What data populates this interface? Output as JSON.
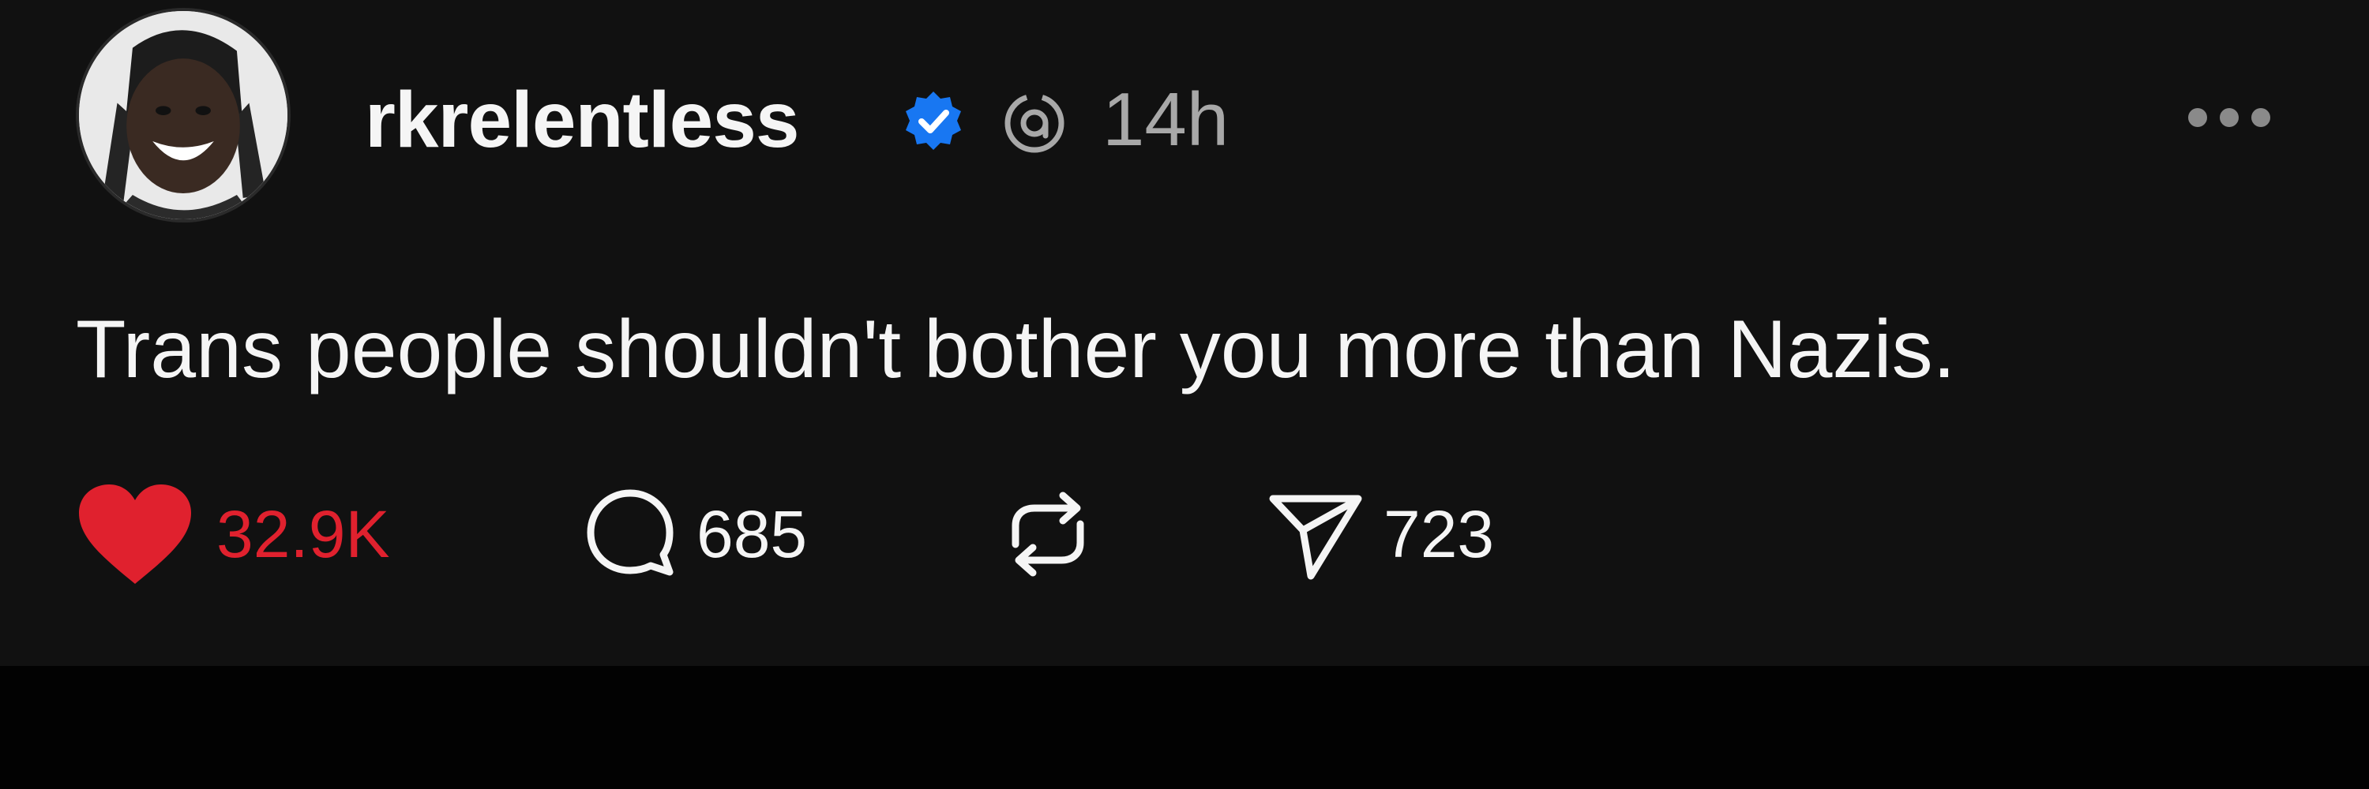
{
  "post": {
    "username": "rkrelentless",
    "time": "14h",
    "text": "Trans people shouldn't bother you more than Nazis."
  },
  "actions": {
    "likes": "32.9K",
    "comments": "685",
    "shares": "723"
  },
  "icons": {
    "avatar": "profile-photo",
    "verified": "verified-badge-icon",
    "threads": "threads-logo-icon",
    "more": "more-options-icon",
    "like": "heart-icon",
    "comment": "comment-bubble-icon",
    "repost": "repost-icon",
    "share": "send-icon"
  },
  "colors": {
    "background": "#111111",
    "text": "#f5f5f5",
    "muted": "#a8a8a8",
    "like": "#e0212e",
    "verified": "#1877f2"
  }
}
